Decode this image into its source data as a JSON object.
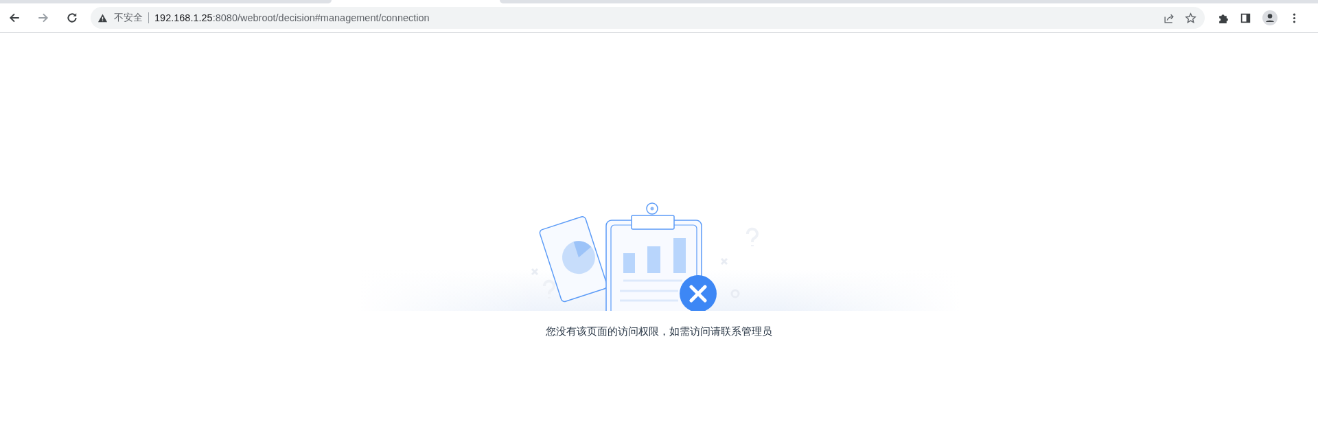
{
  "browser": {
    "security_label": "不安全",
    "url_host": "192.168.1.25",
    "url_path": ":8080/webroot/decision#management/connection"
  },
  "message": "您没有该页面的访问权限，如需访问请联系管理员"
}
